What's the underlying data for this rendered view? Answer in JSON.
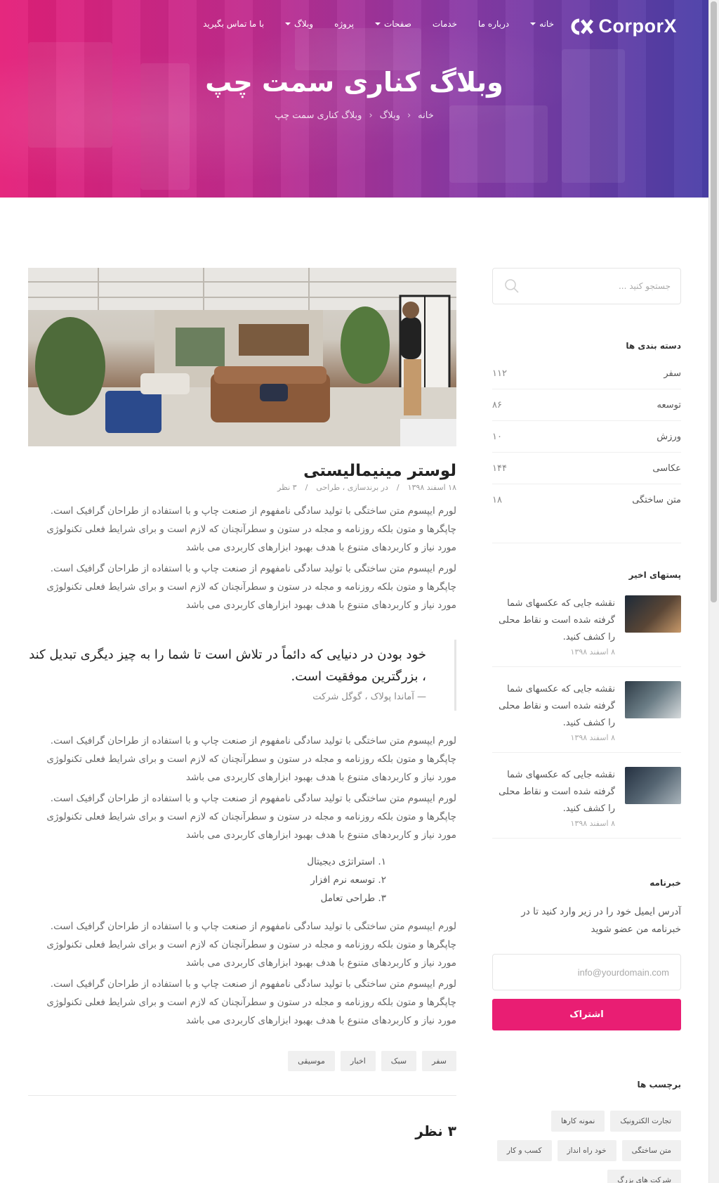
{
  "brand": {
    "name": "CorporX",
    "accent": "#e91e73"
  },
  "nav": {
    "items": [
      {
        "label": "خانه",
        "dropdown": true
      },
      {
        "label": "درباره ما",
        "dropdown": false
      },
      {
        "label": "خدمات",
        "dropdown": false
      },
      {
        "label": "صفحات",
        "dropdown": true
      },
      {
        "label": "پروژه",
        "dropdown": false
      },
      {
        "label": "وبلاگ",
        "dropdown": true
      },
      {
        "label": "با ما تماس بگیرید",
        "dropdown": false
      }
    ]
  },
  "hero": {
    "title": "وبلاگ کناری سمت چپ",
    "breadcrumb": [
      "خانه",
      "وبلاگ",
      "وبلاگ کناری سمت چپ"
    ]
  },
  "post": {
    "title": "لوستر مینیمالیستی",
    "date": "۱۸ اسفند ۱۳۹۸",
    "categories": "در برندسازی ، طراحی",
    "comments": "۳ نظر",
    "meta_sep": "/",
    "para1": "لورم ایپسوم متن ساختگی با تولید سادگی نامفهوم از صنعت چاپ و با استفاده از طراحان گرافیک است. چاپگرها و متون بلکه روزنامه و مجله در ستون و سطرآنچنان که لازم است و برای شرایط فعلی تکنولوژی مورد نیاز و کاربردهای متنوع با هدف بهبود ابزارهای کاربردی می باشد",
    "para2": "لورم ایپسوم متن ساختگی با تولید سادگی نامفهوم از صنعت چاپ و با استفاده از طراحان گرافیک است. چاپگرها و متون بلکه روزنامه و مجله در ستون و سطرآنچنان که لازم است و برای شرایط فعلی تکنولوژی مورد نیاز و کاربردهای متنوع با هدف بهبود ابزارهای کاربردی می باشد",
    "quote": {
      "text": "خود بودن در دنیایی که دائماً در تلاش است تا شما را به چیز دیگری تبدیل کند ، بزرگترین موفقیت است.",
      "cite": "— آماندا پولاک ، گوگل شرکت"
    },
    "para3": "لورم ایپسوم متن ساختگی با تولید سادگی نامفهوم از صنعت چاپ و با استفاده از طراحان گرافیک است. چاپگرها و متون بلکه روزنامه و مجله در ستون و سطرآنچنان که لازم است و برای شرایط فعلی تکنولوژی مورد نیاز و کاربردهای متنوع با هدف بهبود ابزارهای کاربردی می باشد",
    "para4": "لورم ایپسوم متن ساختگی با تولید سادگی نامفهوم از صنعت چاپ و با استفاده از طراحان گرافیک است. چاپگرها و متون بلکه روزنامه و مجله در ستون و سطرآنچنان که لازم است و برای شرایط فعلی تکنولوژی مورد نیاز و کاربردهای متنوع با هدف بهبود ابزارهای کاربردی می باشد",
    "list": [
      "۱. استراتژی دیجیتال",
      "۲. توسعه نرم افزار",
      "۳. طراحی تعامل"
    ],
    "para5": "لورم ایپسوم متن ساختگی با تولید سادگی نامفهوم از صنعت چاپ و با استفاده از طراحان گرافیک است. چاپگرها و متون بلکه روزنامه و مجله در ستون و سطرآنچنان که لازم است و برای شرایط فعلی تکنولوژی مورد نیاز و کاربردهای متنوع با هدف بهبود ابزارهای کاربردی می باشد",
    "para6": "لورم ایپسوم متن ساختگی با تولید سادگی نامفهوم از صنعت چاپ و با استفاده از طراحان گرافیک است. چاپگرها و متون بلکه روزنامه و مجله در ستون و سطرآنچنان که لازم است و برای شرایط فعلی تکنولوژی مورد نیاز و کاربردهای متنوع با هدف بهبود ابزارهای کاربردی می باشد",
    "tags": [
      "سفر",
      "سبک",
      "اخبار",
      "موسیقی"
    ],
    "comments_title": "۳ نظر"
  },
  "sidebar": {
    "search_placeholder": "جستجو کنید ...",
    "categories_title": "دسته بندی ها",
    "categories": [
      {
        "name": "سفر",
        "count": "۱۱۲"
      },
      {
        "name": "توسعه",
        "count": "۸۶"
      },
      {
        "name": "ورزش",
        "count": "۱۰"
      },
      {
        "name": "عکاسی",
        "count": "۱۴۴"
      },
      {
        "name": "متن ساختگی",
        "count": "۱۸"
      }
    ],
    "recent_title": "پستهای اخیر",
    "recent": [
      {
        "text": "نقشه جایی که عکسهای شما گرفته شده است و نقاط محلی را کشف کنید.",
        "date": "۸ اسفند ۱۳۹۸"
      },
      {
        "text": "نقشه جایی که عکسهای شما گرفته شده است و نقاط محلی را کشف کنید.",
        "date": "۸ اسفند ۱۳۹۸"
      },
      {
        "text": "نقشه جایی که عکسهای شما گرفته شده است و نقاط محلی را کشف کنید.",
        "date": "۸ اسفند ۱۳۹۸"
      }
    ],
    "newsletter_title": "خبرنامه",
    "newsletter_desc": "آدرس ایمیل خود را در زیر وارد کنید تا در خبرنامه من عضو شوید",
    "email_placeholder": "info@yourdomain.com",
    "subscribe_label": "اشتراک",
    "tags_title": "برچسب ها",
    "tags": [
      "تجارت الکترونیک",
      "نمونه کارها",
      "متن ساختگی",
      "خود راه انداز",
      "کسب و کار",
      "شرکت های بزرگ"
    ]
  }
}
